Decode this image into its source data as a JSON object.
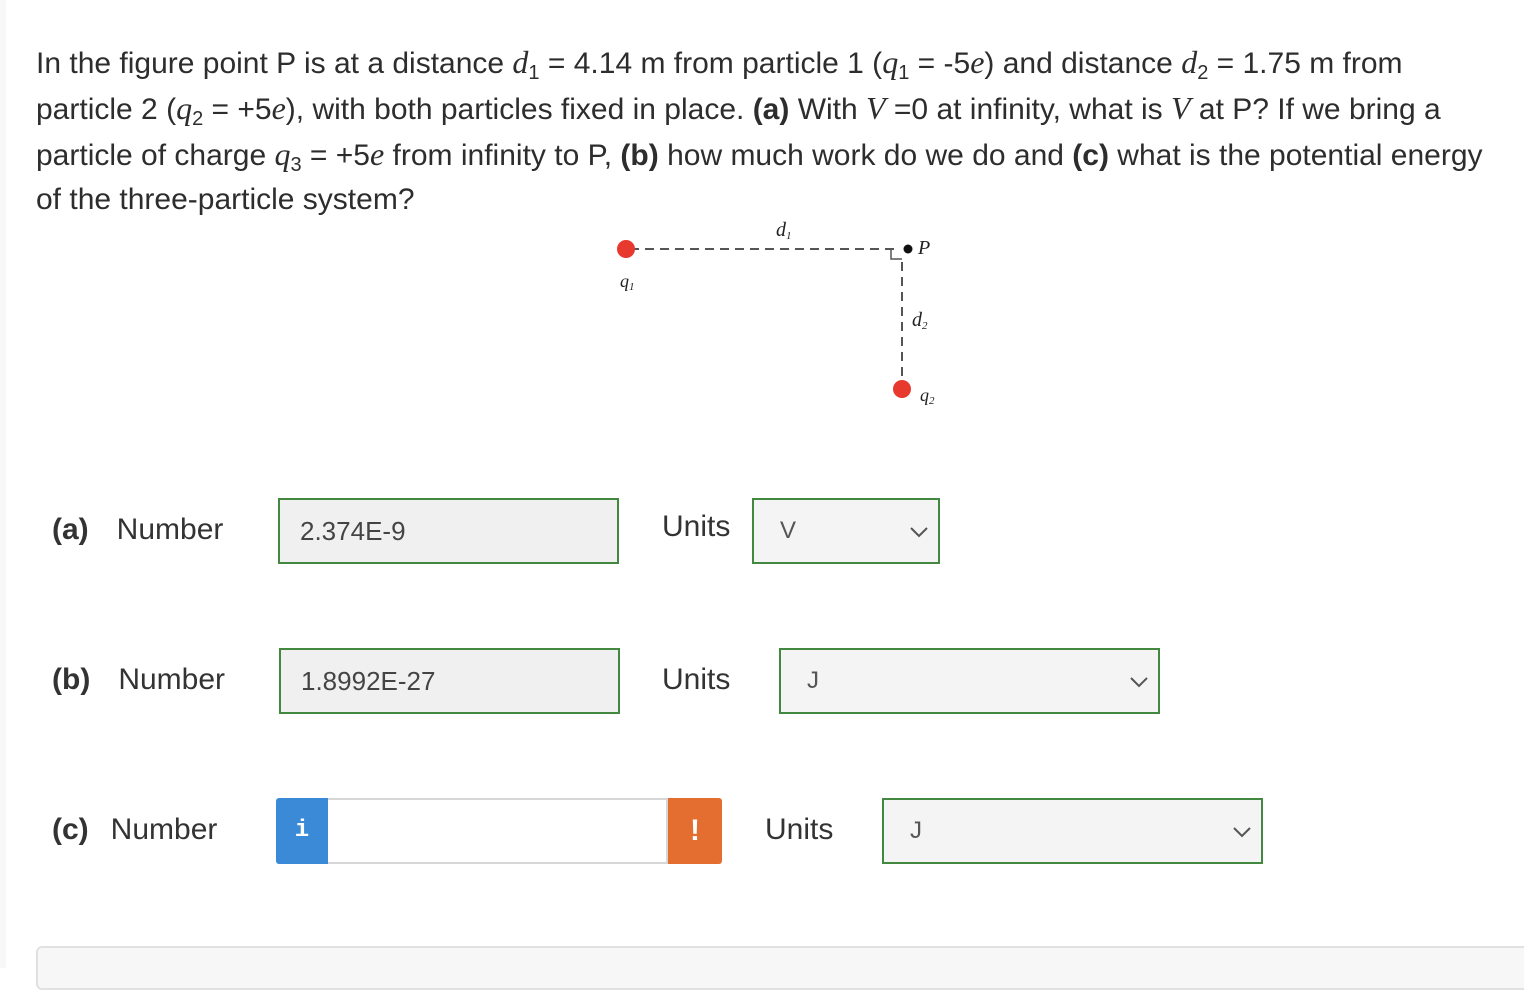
{
  "question": {
    "seg1": "In the figure point P is at a distance ",
    "d1_sym": "d",
    "d1_sub": "1",
    "seg2": " = 4.14 m from particle 1 (",
    "q1_sym": "q",
    "q1_sub": "1",
    "seg3": " = -5",
    "e1": "e",
    "seg4": ") and distance ",
    "d2_sym": "d",
    "d2_sub": "2",
    "seg5": " = 1.75 m from particle 2 (",
    "q2_sym": "q",
    "q2_sub": "2",
    "seg6": " = +5",
    "e2": "e",
    "seg7": "), with both particles fixed in place. ",
    "part_a": "(a)",
    "seg8": " With ",
    "v1": "V",
    "seg9": " =0 at infinity, what is ",
    "v2": "V",
    "seg10": " at P? If we bring a particle of charge ",
    "q3_sym": "q",
    "q3_sub": "3",
    "seg11": " = +5",
    "e3": "e",
    "seg12": " from infinity to P, ",
    "part_b": "(b)",
    "seg13": " how much work do we do and ",
    "part_c": "(c)",
    "seg14": " what is the potential energy of the three-particle system?"
  },
  "figure": {
    "d1_label": "d",
    "d1_sub": "1",
    "p_label": "P",
    "q1_label": "q",
    "q1_sub": "1",
    "d2_label": "d",
    "d2_sub": "2",
    "q2_label": "q",
    "q2_sub": "2",
    "colors": {
      "particle": "#e8392f",
      "dash": "#555555"
    }
  },
  "rows": [
    {
      "part": "(a)",
      "label": "Number",
      "value": "2.374E-9",
      "units_label": "Units",
      "unit": "V"
    },
    {
      "part": "(b)",
      "label": "Number",
      "value": "1.8992E-27",
      "units_label": "Units",
      "unit": "J"
    },
    {
      "part": "(c)",
      "label": "Number",
      "value": "",
      "units_label": "Units",
      "unit": "J",
      "info_icon": "i",
      "warning_icon": "!"
    }
  ],
  "colors": {
    "accent": "#43883f",
    "info": "#3a8ad8",
    "warning": "#e36e2f"
  }
}
